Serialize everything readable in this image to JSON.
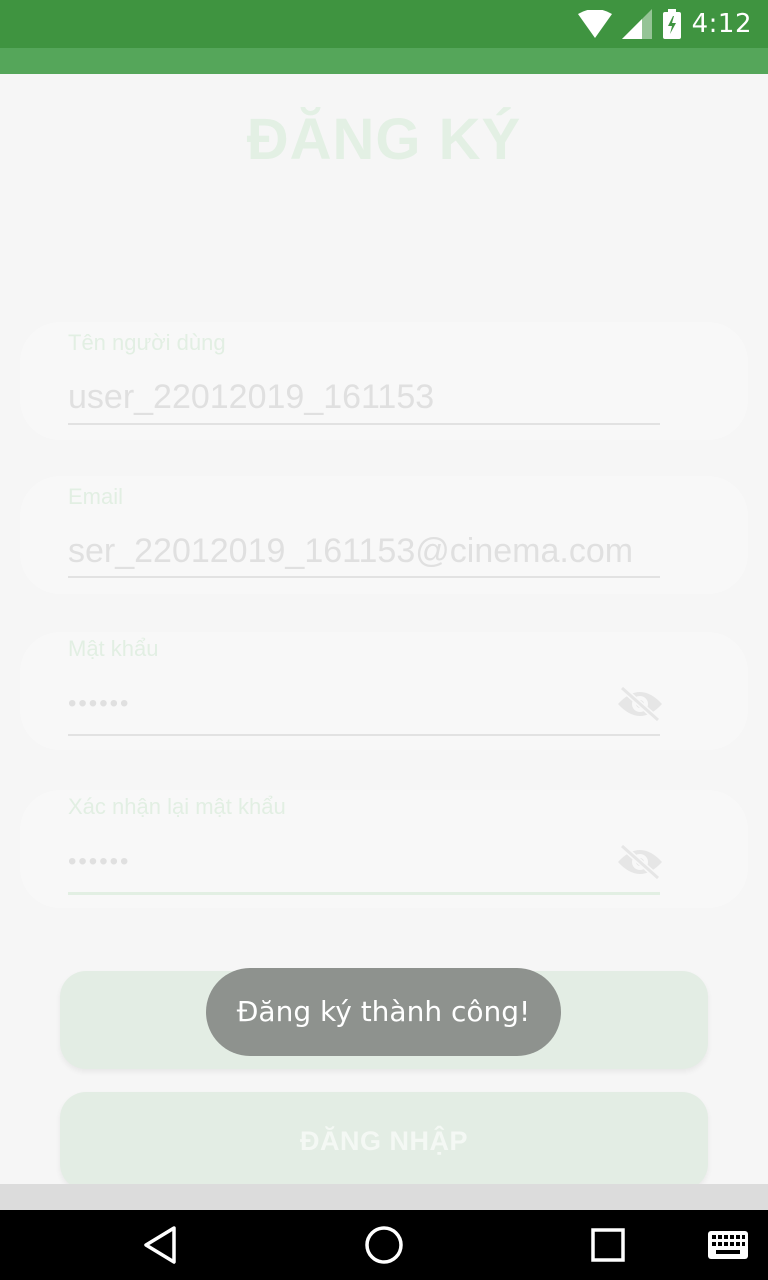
{
  "status_bar": {
    "time": "4:12",
    "icons": [
      "wifi-icon",
      "signal-icon",
      "battery-charging-icon"
    ]
  },
  "screen": {
    "title": "ĐĂNG KÝ"
  },
  "form": {
    "username": {
      "label": "Tên người dùng",
      "value": "user_22012019_161153"
    },
    "email": {
      "label": "Email",
      "value": "ser_22012019_161153@cinema.com"
    },
    "password": {
      "label": "Mật khẩu",
      "value": "••••••",
      "toggle_icon": "visibility-off-icon"
    },
    "confirm_password": {
      "label": "Xác nhận lại mật khẩu",
      "value": "••••••",
      "toggle_icon": "visibility-off-icon"
    }
  },
  "buttons": {
    "register_label": "",
    "login_label": "ĐĂNG NHẬP"
  },
  "toast": {
    "message": "Đăng ký thành công!"
  },
  "nav_bar": {
    "icons": [
      "back-icon",
      "home-icon",
      "recents-icon",
      "keyboard-icon"
    ]
  },
  "colors": {
    "status_bar": "#3f9440",
    "app_bar": "#55a65a",
    "accent_faded": "#e3f0e4",
    "toast_bg": "#8e928e"
  }
}
